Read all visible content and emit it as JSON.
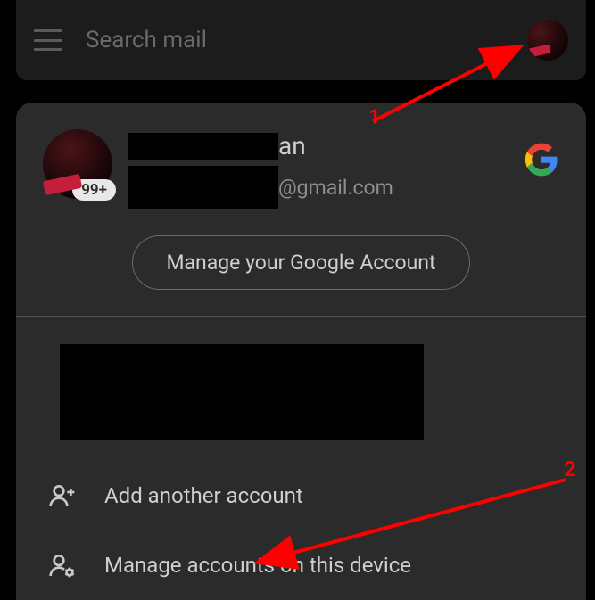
{
  "search": {
    "placeholder": "Search mail"
  },
  "account": {
    "name_suffix": "an",
    "email_suffix": "@gmail.com",
    "badge": "99+",
    "manage_button": "Manage your Google Account"
  },
  "menu": {
    "add_account": "Add another account",
    "manage_devices": "Manage accounts on this device"
  },
  "annotations": {
    "label1": "1",
    "label2": "2"
  }
}
